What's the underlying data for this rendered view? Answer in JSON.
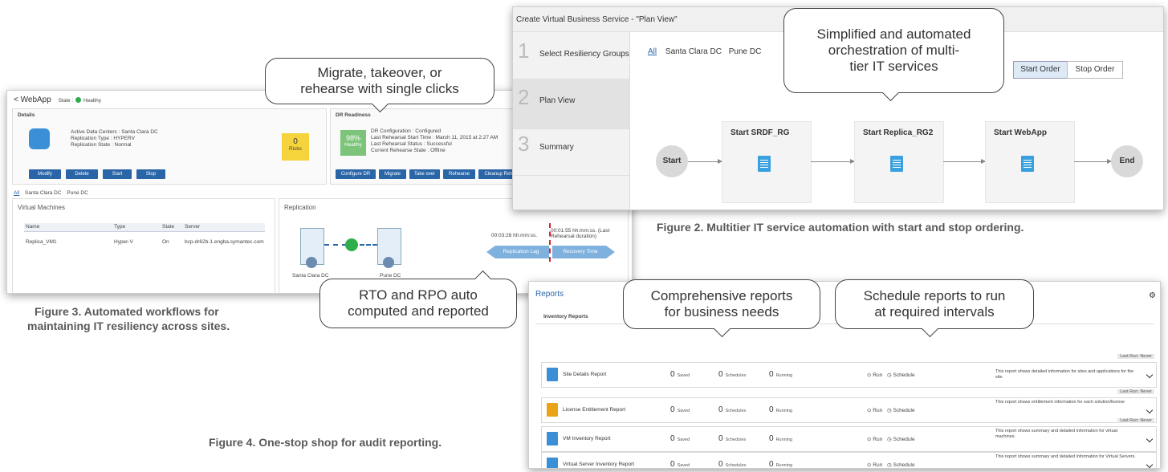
{
  "callouts": {
    "c1": [
      "Migrate, takeover, or",
      "rehearse with single clicks"
    ],
    "c2": [
      "Simplified and automated",
      "orchestration of multi-",
      "tier IT services"
    ],
    "c3": [
      "RTO and RPO auto",
      "computed and reported"
    ],
    "c4": [
      "Comprehensive reports",
      "for business needs"
    ],
    "c5": [
      "Schedule reports to run",
      "at required intervals"
    ]
  },
  "captions": {
    "fig2": "Figure 2. Multitier IT service automation with start and stop ordering.",
    "fig3_line1": "Figure 3. Automated workflows for",
    "fig3_line2": "maintaining IT resiliency across sites.",
    "fig4": "Figure 4. One-stop shop for audit reporting."
  },
  "fig3": {
    "back": "< WebApp",
    "state_label": "State :",
    "state_value": "Healthy",
    "details_title": "Details",
    "details_lines": [
      "Active Data Centers : Santa Clara DC",
      "Replication Type : HYPERV",
      "Replication State : Normal"
    ],
    "risks_value": "0",
    "risks_label": "Risks",
    "actions": [
      "Modify",
      "Delete",
      "Start",
      "Stop"
    ],
    "dr_title": "DR Readiness",
    "dr_pct": "98%",
    "dr_status": "Healthy",
    "dr_lines": [
      "DR Configuration : Configured",
      "Last Rehearsal Start Time : March 11, 2015 at 2:27 AM",
      "Last Rehearsal Status : Successful",
      "Current Rehearse State : Offline"
    ],
    "dr_actions": [
      "Configure DR",
      "Migrate",
      "Take over",
      "Rehearse",
      "Cleanup Reh"
    ],
    "filters": [
      "All",
      "Santa Clara DC",
      "Pune DC"
    ],
    "vm_title": "Virtual Machines",
    "vm_columns": [
      "Name",
      "Type",
      "State",
      "Server"
    ],
    "vm_rows": [
      [
        "Replica_VM1",
        "Hyper-V",
        "On",
        "bcp-dr62b-1.engba.symantec.com"
      ]
    ],
    "repl_title": "Replication",
    "site_a": "Santa Clara DC",
    "site_b": "Pune DC",
    "lag_time": "00:03:28 hh:mm:ss.",
    "rec_time": "00:01:55 hh:mm:ss. (Last Rehearsal duration)",
    "lag_label": "Replication Lag",
    "rec_label": "Recovery Time"
  },
  "fig2": {
    "title": "Create Virtual Business Service - \"Plan View\"",
    "steps": [
      {
        "num": "1",
        "label": "Select Resiliency Groups"
      },
      {
        "num": "2",
        "label": "Plan View"
      },
      {
        "num": "3",
        "label": "Summary"
      }
    ],
    "filters": [
      "All",
      "Santa Clara DC",
      "Pune DC"
    ],
    "order_buttons": [
      "Start Order",
      "Stop Order"
    ],
    "start": "Start",
    "end": "End",
    "nodes": [
      "Start SRDF_RG",
      "Start Replica_RG2",
      "Start WebApp"
    ]
  },
  "fig4": {
    "title": "Reports",
    "section": "Inventory Reports",
    "last_run": "Last Run: Never",
    "saved_label": "Saved",
    "sched_label": "Schedules",
    "running_label": "Running",
    "run_label": "Run",
    "schedule_label": "Schedule",
    "reports": [
      {
        "name": "Site Details Report",
        "saved": "0",
        "schedules": "0",
        "running": "0",
        "desc": "This report shows detailed information for sites and applications for the site.",
        "color": "#3a8fd6"
      },
      {
        "name": "License Entitlement Report",
        "saved": "0",
        "schedules": "0",
        "running": "0",
        "desc": "This report shows entitlement information for each solution/license",
        "color": "#e8a317"
      },
      {
        "name": "VM Inventory Report",
        "saved": "0",
        "schedules": "0",
        "running": "0",
        "desc": "This report shows summary and detailed information for virtual machines.",
        "color": "#3a8fd6"
      },
      {
        "name": "Virtual Server Inventory Report",
        "saved": "0",
        "schedules": "0",
        "running": "0",
        "desc": "This report shows summary and detailed information for Virtual Servers.",
        "color": "#3a8fd6"
      }
    ]
  },
  "colors": {
    "accent": "#2a65a8",
    "green": "#2eae4a",
    "yellow": "#f5d33a",
    "light_blue_arrow": "#7fb1de"
  }
}
